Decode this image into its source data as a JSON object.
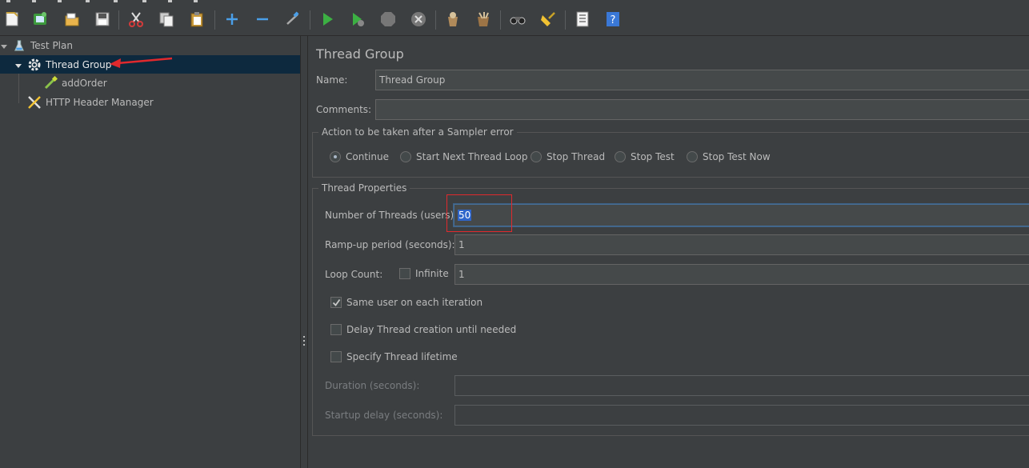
{
  "toolbar": {
    "buttons": [
      {
        "icon": "new-icon"
      },
      {
        "icon": "templates-icon"
      },
      {
        "icon": "open-icon"
      },
      {
        "icon": "save-icon"
      },
      {
        "icon": "cut-icon"
      },
      {
        "icon": "copy-icon"
      },
      {
        "icon": "paste-icon"
      },
      {
        "icon": "expand-icon"
      },
      {
        "icon": "collapse-icon"
      },
      {
        "icon": "toggle-icon"
      },
      {
        "icon": "start-icon"
      },
      {
        "icon": "start-no-pauses-icon"
      },
      {
        "icon": "stop-icon"
      },
      {
        "icon": "shutdown-icon"
      },
      {
        "icon": "clear-icon"
      },
      {
        "icon": "clear-all-icon"
      },
      {
        "icon": "search-icon"
      },
      {
        "icon": "reset-search-icon"
      },
      {
        "icon": "function-helper-icon"
      },
      {
        "icon": "help-icon"
      }
    ]
  },
  "tree": {
    "items": [
      {
        "label": "Test Plan",
        "icon": "flask-icon",
        "expanded": true,
        "selected": false
      },
      {
        "label": "Thread Group",
        "icon": "gear-icon",
        "expanded": true,
        "selected": true
      },
      {
        "label": "addOrder",
        "icon": "pipette-icon",
        "selected": false
      },
      {
        "label": "HTTP Header Manager",
        "icon": "tools-icon",
        "selected": false
      }
    ]
  },
  "panel": {
    "title": "Thread Group",
    "name_label": "Name:",
    "name_value": "Thread Group",
    "comments_label": "Comments:",
    "comments_value": "",
    "sampler_error": {
      "title": "Action to be taken after a Sampler error",
      "options": [
        "Continue",
        "Start Next Thread Loop",
        "Stop Thread",
        "Stop Test",
        "Stop Test Now"
      ],
      "selected": "Continue"
    },
    "thread_properties": {
      "title": "Thread Properties",
      "num_threads_label": "Number of Threads (users):",
      "num_threads_value": "50",
      "rampup_label": "Ramp-up period (seconds):",
      "rampup_value": "1",
      "loop_label": "Loop Count:",
      "infinite_label": "Infinite",
      "infinite_checked": false,
      "loop_value": "1",
      "same_user_label": "Same user on each iteration",
      "same_user_checked": true,
      "delay_label": "Delay Thread creation until needed",
      "delay_checked": false,
      "lifetime_label": "Specify Thread lifetime",
      "lifetime_checked": false,
      "duration_label": "Duration (seconds):",
      "duration_value": "",
      "startup_label": "Startup delay (seconds):",
      "startup_value": ""
    }
  },
  "colors": {
    "background": "#3c3f41",
    "selection": "#0d293e",
    "annotation_red": "#e0292d",
    "text_selection": "#2f65ca"
  }
}
